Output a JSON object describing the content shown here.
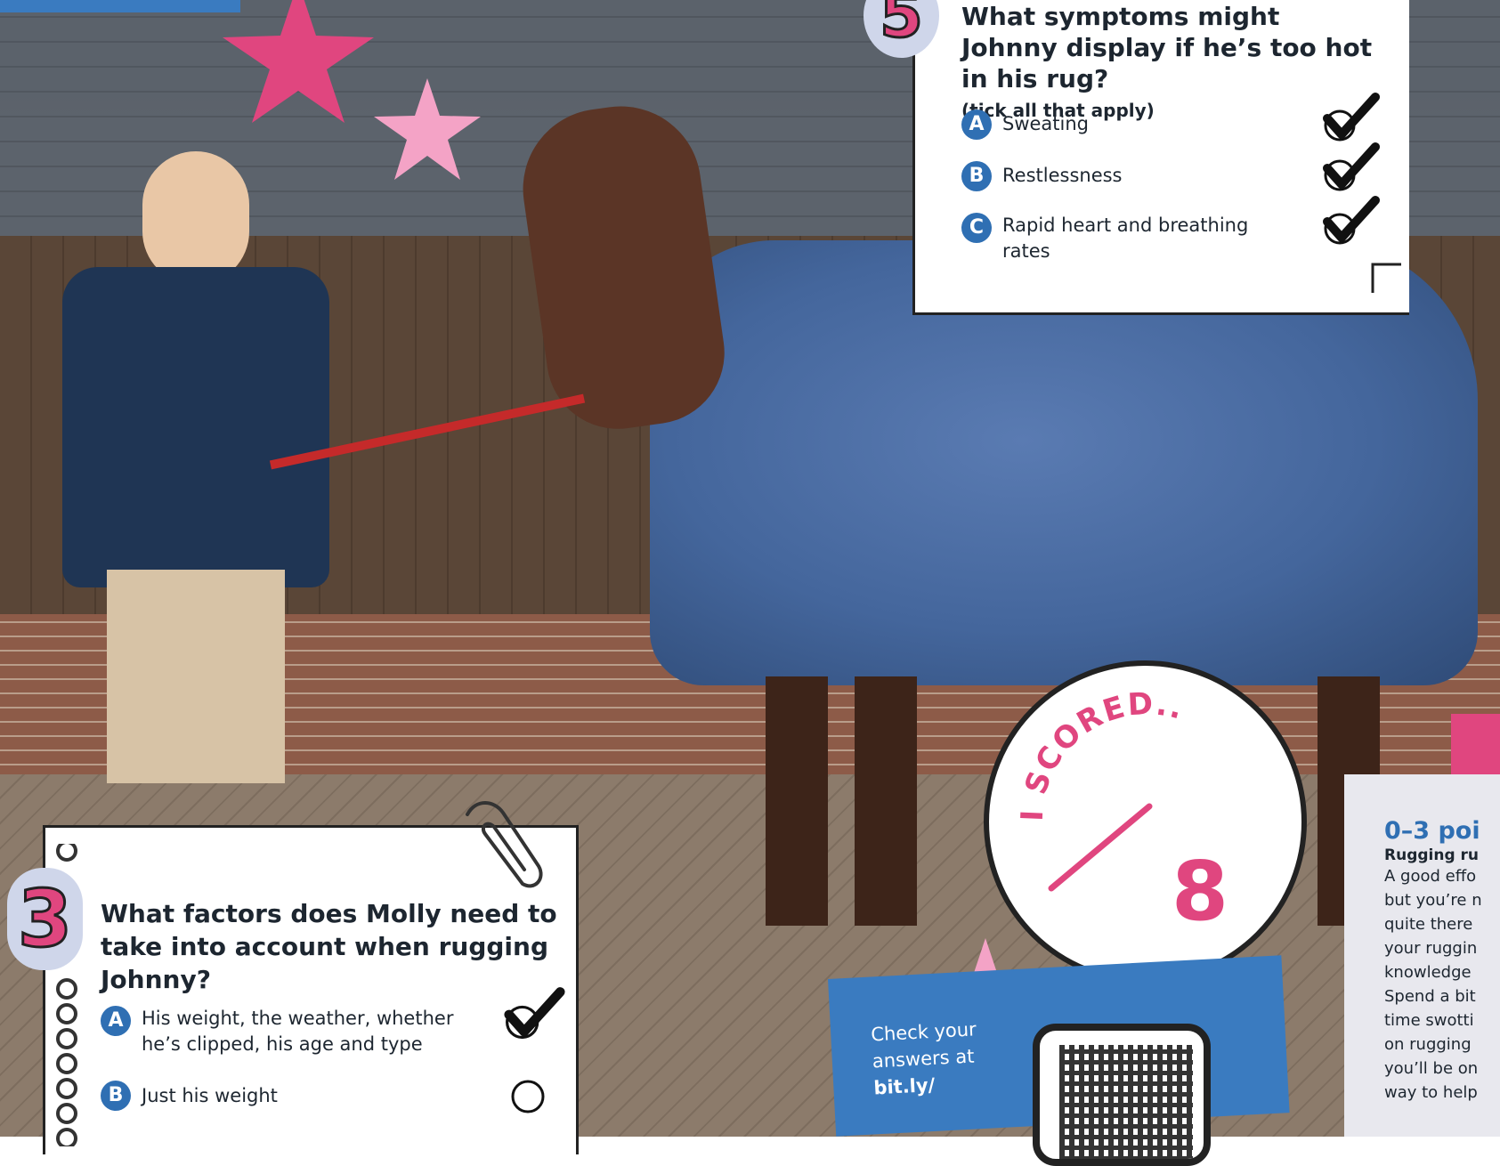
{
  "question5": {
    "number": "5",
    "title_line1": "What symptoms might",
    "title_line2": "Johnny display if he’s too hot",
    "title_line3": "in his rug?",
    "subtitle": "(tick all that apply)",
    "options": [
      {
        "letter": "A",
        "text": "Sweating",
        "ticked": true
      },
      {
        "letter": "B",
        "text": "Restlessness",
        "ticked": true
      },
      {
        "letter": "C",
        "text": "Rapid heart and breathing rates",
        "ticked": true
      }
    ]
  },
  "question3": {
    "number": "3",
    "title": "What factors does Molly need to take into account when rugging Johnny?",
    "options": [
      {
        "letter": "A",
        "text": "His weight, the weather, whether he’s clipped, his age and type",
        "ticked": true
      },
      {
        "letter": "B",
        "text": "Just his weight",
        "ticked": false
      }
    ]
  },
  "score": {
    "label": "I SCORED....",
    "total": "8"
  },
  "check_answers": {
    "line1": "Check your",
    "line2": "answers at",
    "line3": "bit.ly/"
  },
  "points_panel": {
    "heading": "0–3 poi",
    "subheading": "Rugging ru",
    "lines": [
      "A good effo",
      "but you’re n",
      "quite there",
      "your ruggin",
      "knowledge",
      "Spend a bit",
      "time swotti",
      "on rugging",
      "you’ll be on",
      "way to help"
    ]
  },
  "colors": {
    "pink": "#e0467f",
    "light_pink": "#f4a3c6",
    "blue": "#2f6fb3",
    "banner_blue": "#3a7bc0",
    "badge_bg": "#cfd6ea"
  }
}
